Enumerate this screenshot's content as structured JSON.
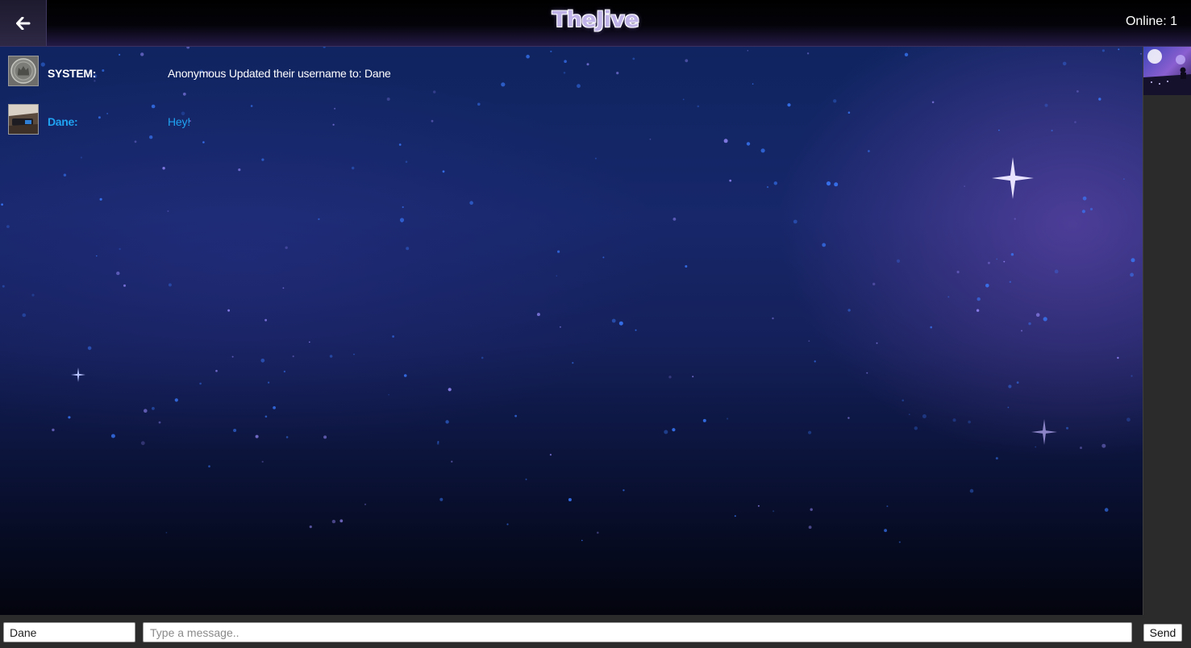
{
  "header": {
    "back_icon": "arrow-left-icon",
    "title": "TheJive",
    "online_label": "Online: 1"
  },
  "messages": [
    {
      "author": "SYSTEM:",
      "text": "Anonymous Updated their username to: Dane",
      "author_color": "#ffffff",
      "text_color": "#ffffff",
      "avatar": "system-seal-avatar"
    },
    {
      "author": "Dane:",
      "text": "Hey!",
      "author_color": "#1fa3f2",
      "text_color": "#1fa3f2",
      "avatar": "user-photo-avatar"
    }
  ],
  "sidebar": {
    "avatar": "concert-photo-avatar"
  },
  "composer": {
    "name_value": "Dane",
    "message_placeholder": "Type a message..",
    "send_label": "Send"
  },
  "colors": {
    "header_bg": "#000000",
    "panel_bg": "#2b2b2b",
    "accent_user": "#1fa3f2",
    "title_fill": "#bfb3e8"
  }
}
